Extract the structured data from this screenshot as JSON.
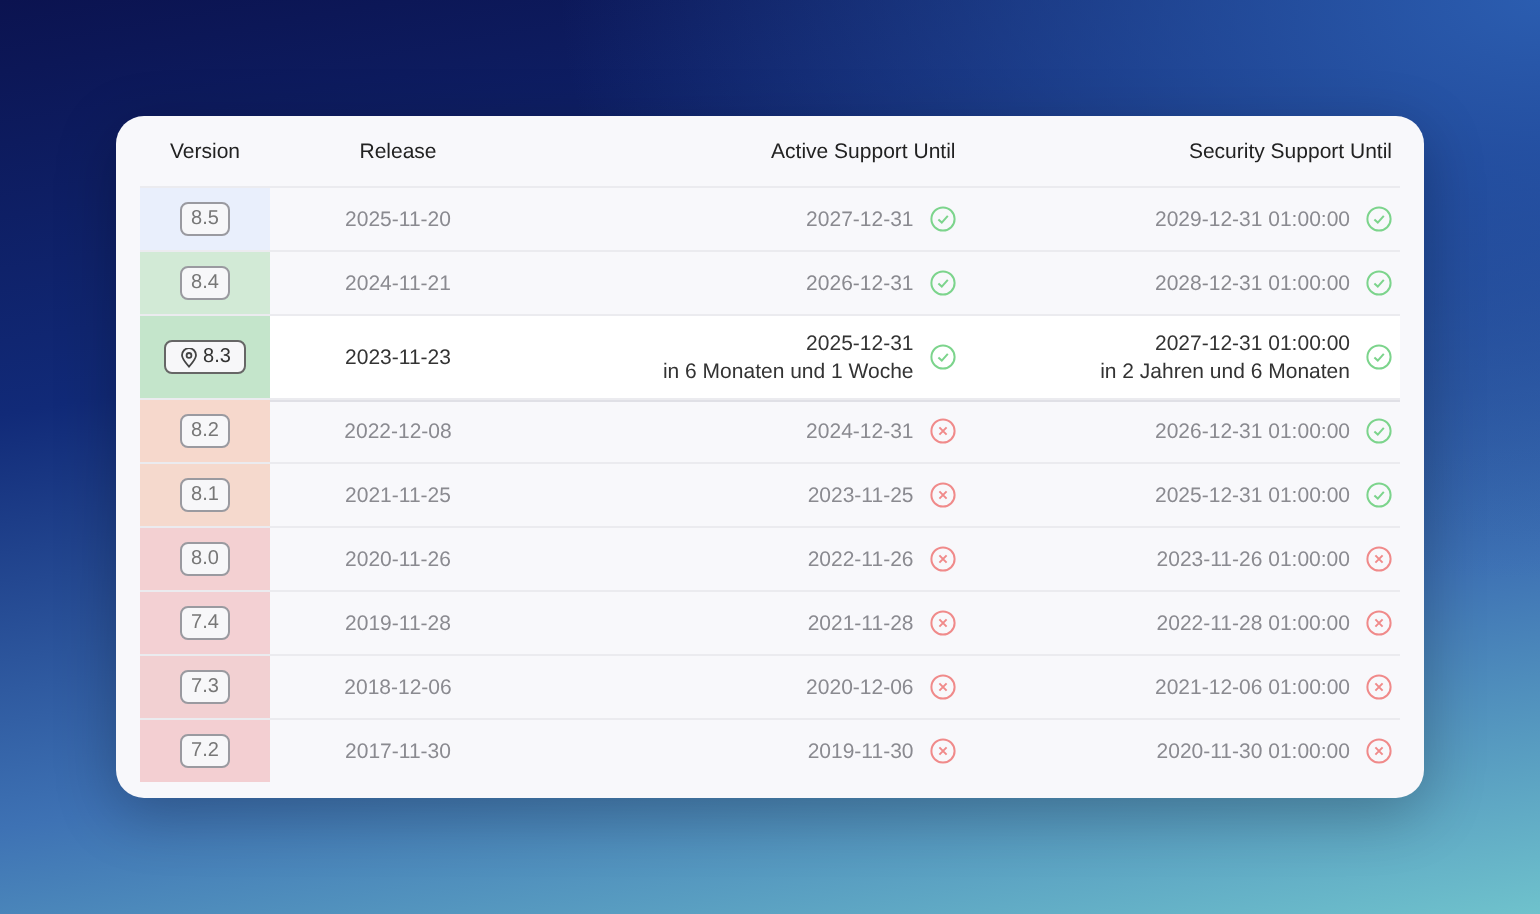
{
  "table": {
    "columns": [
      "Version",
      "Release",
      "Active Support Until",
      "Security Support Until"
    ],
    "rows": [
      {
        "version": "8.5",
        "color": "#e9effc",
        "selected": false,
        "release": "2025-11-20",
        "active": {
          "date": "2027-12-31",
          "supported": true
        },
        "security": {
          "date": "2029-12-31 01:00:00",
          "supported": true
        }
      },
      {
        "version": "8.4",
        "color": "#d2ead6",
        "selected": false,
        "release": "2024-11-21",
        "active": {
          "date": "2026-12-31",
          "supported": true
        },
        "security": {
          "date": "2028-12-31 01:00:00",
          "supported": true
        }
      },
      {
        "version": "8.3",
        "color": "#c4e5cb",
        "selected": true,
        "release": "2023-11-23",
        "active": {
          "date": "2025-12-31",
          "relative": "in 6 Monaten und 1 Woche",
          "supported": true
        },
        "security": {
          "date": "2027-12-31 01:00:00",
          "relative": "in 2 Jahren und 6 Monaten",
          "supported": true
        }
      },
      {
        "version": "8.2",
        "color": "#f6d8cc",
        "selected": false,
        "release": "2022-12-08",
        "active": {
          "date": "2024-12-31",
          "supported": false
        },
        "security": {
          "date": "2026-12-31 01:00:00",
          "supported": true
        }
      },
      {
        "version": "8.1",
        "color": "#f5d9cd",
        "selected": false,
        "release": "2021-11-25",
        "active": {
          "date": "2023-11-25",
          "supported": false
        },
        "security": {
          "date": "2025-12-31 01:00:00",
          "supported": true
        }
      },
      {
        "version": "8.0",
        "color": "#f3d0d2",
        "selected": false,
        "release": "2020-11-26",
        "active": {
          "date": "2022-11-26",
          "supported": false
        },
        "security": {
          "date": "2023-11-26 01:00:00",
          "supported": false
        }
      },
      {
        "version": "7.4",
        "color": "#f3d0d3",
        "selected": false,
        "release": "2019-11-28",
        "active": {
          "date": "2021-11-28",
          "supported": false
        },
        "security": {
          "date": "2022-11-28 01:00:00",
          "supported": false
        }
      },
      {
        "version": "7.3",
        "color": "#f2d0d2",
        "selected": false,
        "release": "2018-12-06",
        "active": {
          "date": "2020-12-06",
          "supported": false
        },
        "security": {
          "date": "2021-12-06 01:00:00",
          "supported": false
        }
      },
      {
        "version": "7.2",
        "color": "#f3cfd2",
        "selected": false,
        "release": "2017-11-30",
        "active": {
          "date": "2019-11-30",
          "supported": false
        },
        "security": {
          "date": "2020-11-30 01:00:00",
          "supported": false
        }
      }
    ]
  }
}
